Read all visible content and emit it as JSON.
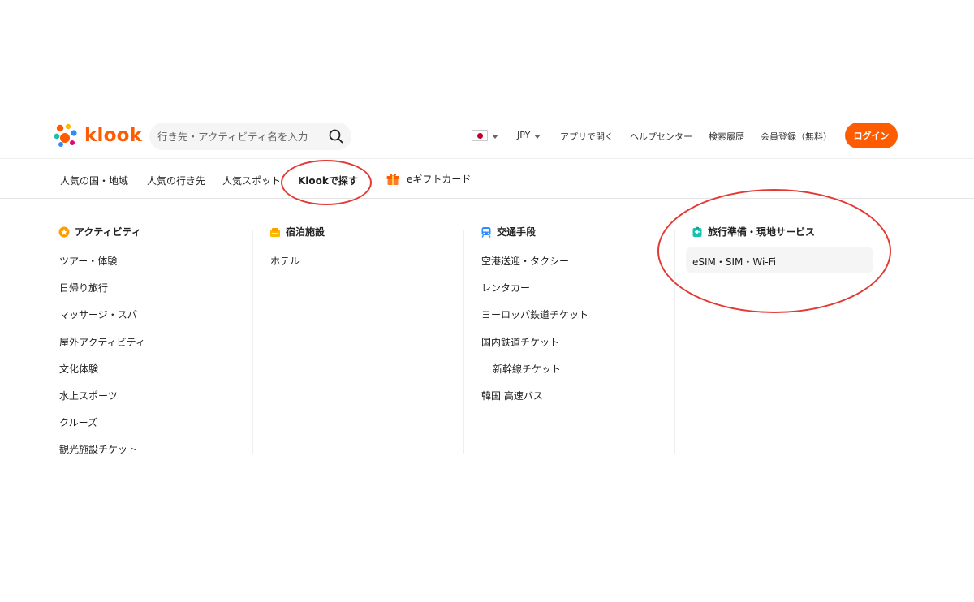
{
  "header": {
    "logo_text": "klook",
    "search_placeholder": "行き先・アクティビティ名を入力",
    "currency": "JPY",
    "links": [
      "アプリで開く",
      "ヘルプセンター",
      "検索履歴",
      "会員登録（無料）"
    ],
    "login_label": "ログイン"
  },
  "categories": [
    "人気の国・地域",
    "人気の行き先",
    "人気スポット",
    "Klookで探す",
    "eギフトカード"
  ],
  "menu": {
    "columns": [
      {
        "title": "アクティビティ",
        "icon": "activity-icon",
        "items": [
          "ツアー・体験",
          "日帰り旅行",
          "マッサージ・スパ",
          "屋外アクティビティ",
          "文化体験",
          "水上スポーツ",
          "クルーズ",
          "観光施設チケット"
        ]
      },
      {
        "title": "宿泊施設",
        "icon": "hotel-icon",
        "items": [
          "ホテル"
        ]
      },
      {
        "title": "交通手段",
        "icon": "train-icon",
        "items": [
          "空港送迎・タクシー",
          "レンタカー",
          "ヨーロッパ鉄道チケット",
          "国内鉄道チケット",
          "新幹線チケット",
          "韓国 高速バス"
        ]
      },
      {
        "title": "旅行準備・現地サービス",
        "icon": "travel-prep-icon",
        "items": [
          "eSIM・SIM・Wi-Fi"
        ]
      }
    ]
  },
  "colors": {
    "brand": "#ff5b00",
    "annotation": "#e53935"
  }
}
